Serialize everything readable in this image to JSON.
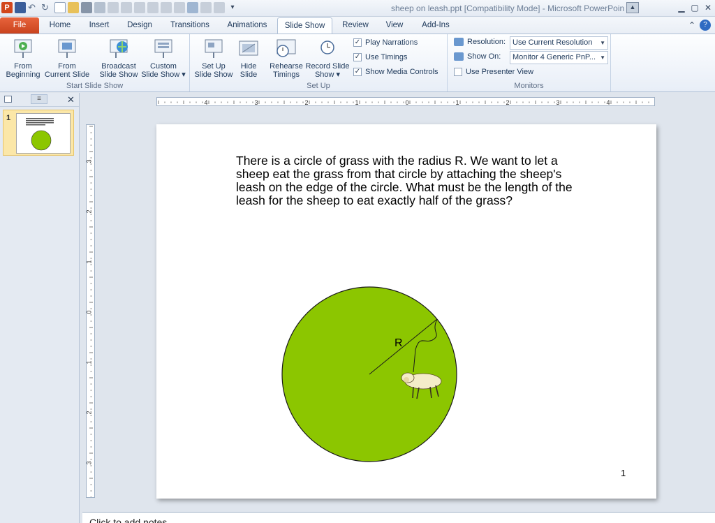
{
  "window": {
    "title": "sheep on leash.ppt [Compatibility Mode] - Microsoft PowerPoin",
    "app_icon": "P"
  },
  "tabs": [
    {
      "label": "File"
    },
    {
      "label": "Home"
    },
    {
      "label": "Insert"
    },
    {
      "label": "Design"
    },
    {
      "label": "Transitions"
    },
    {
      "label": "Animations"
    },
    {
      "label": "Slide Show"
    },
    {
      "label": "Review"
    },
    {
      "label": "View"
    },
    {
      "label": "Add-Ins"
    }
  ],
  "ribbon": {
    "start": {
      "label": "Start Slide Show",
      "from_beginning": [
        "From",
        "Beginning"
      ],
      "from_current": [
        "From",
        "Current Slide"
      ],
      "broadcast": [
        "Broadcast",
        "Slide Show"
      ],
      "custom": [
        "Custom",
        "Slide Show ▾"
      ]
    },
    "setup": {
      "label": "Set Up",
      "setup_show": [
        "Set Up",
        "Slide Show"
      ],
      "hide_slide": [
        "Hide",
        "Slide"
      ],
      "rehearse": [
        "Rehearse",
        "Timings"
      ],
      "record": [
        "Record Slide",
        "Show ▾"
      ],
      "play_narrations": "Play Narrations",
      "use_timings": "Use Timings",
      "show_media": "Show Media Controls"
    },
    "monitors": {
      "label": "Monitors",
      "resolution_label": "Resolution:",
      "resolution_value": "Use Current Resolution",
      "show_on_label": "Show On:",
      "show_on_value": "Monitor 4 Generic PnP...",
      "presenter_view": "Use Presenter View"
    }
  },
  "slides_panel": {
    "slide_number": "1"
  },
  "ruler": {
    "h_labels": [
      "4",
      "3",
      "2",
      "1",
      "0",
      "1",
      "2",
      "3",
      "4"
    ],
    "v_labels": [
      "3",
      "2",
      "1",
      "0",
      "1",
      "2",
      "3"
    ]
  },
  "slide": {
    "text": "There is a circle of grass with the radius R. We want to let a sheep eat the grass from that circle by attaching the sheep's leash on the edge of the circle. What must be the length of the leash for the sheep to eat exactly half of the grass?",
    "radius_label": "R",
    "page_number": "1",
    "circle_color": "#8cc600"
  },
  "notes": {
    "placeholder": "Click to add notes"
  }
}
